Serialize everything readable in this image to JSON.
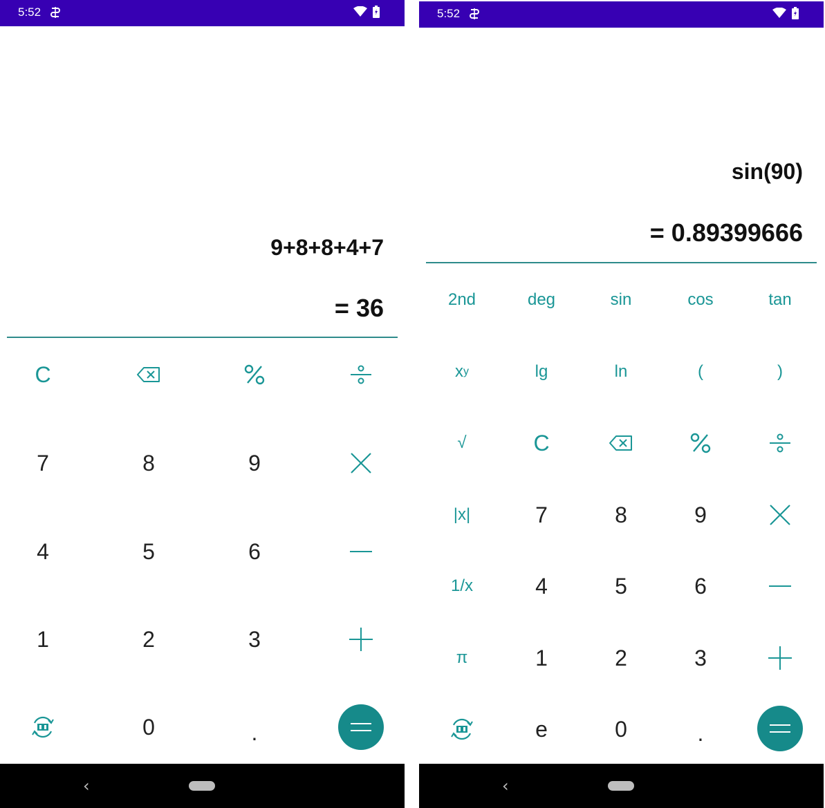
{
  "status_bar": {
    "time": "5:52"
  },
  "left": {
    "expression": "9+8+8+4+7",
    "result": "= 36",
    "keys": {
      "clear": "C",
      "seven": "7",
      "eight": "8",
      "nine": "9",
      "four": "4",
      "five": "5",
      "six": "6",
      "one": "1",
      "two": "2",
      "three": "3",
      "zero": "0",
      "dot": "."
    }
  },
  "right": {
    "expression": "sin(90)",
    "result": "= 0.89399666",
    "keys": {
      "second": "2nd",
      "deg": "deg",
      "sin": "sin",
      "cos": "cos",
      "tan": "tan",
      "power_base": "x",
      "power_exp": "y",
      "lg": "lg",
      "ln": "ln",
      "lparen": "(",
      "rparen": ")",
      "sqrt": "√",
      "clear": "C",
      "abs": "|x|",
      "seven": "7",
      "eight": "8",
      "nine": "9",
      "reciprocal": "1/x",
      "four": "4",
      "five": "5",
      "six": "6",
      "pi": "π",
      "one": "1",
      "two": "2",
      "three": "3",
      "e": "e",
      "zero": "0",
      "dot": "."
    }
  },
  "colors": {
    "status_bar": "#3700b3",
    "accent": "#1a9696",
    "equals_button": "#168a8a",
    "nav_bar": "#000000"
  },
  "icons": {
    "backspace": "backspace-icon",
    "percent": "percent-icon",
    "divide": "divide-icon",
    "multiply": "multiply-icon",
    "minus": "minus-icon",
    "plus": "plus-icon",
    "equals": "equals-icon",
    "mode_switch": "mode-switch-icon",
    "wifi": "wifi-icon",
    "battery": "battery-icon",
    "sim": "data-saver-icon"
  },
  "nav_bar": {
    "back_glyph": "‹"
  }
}
